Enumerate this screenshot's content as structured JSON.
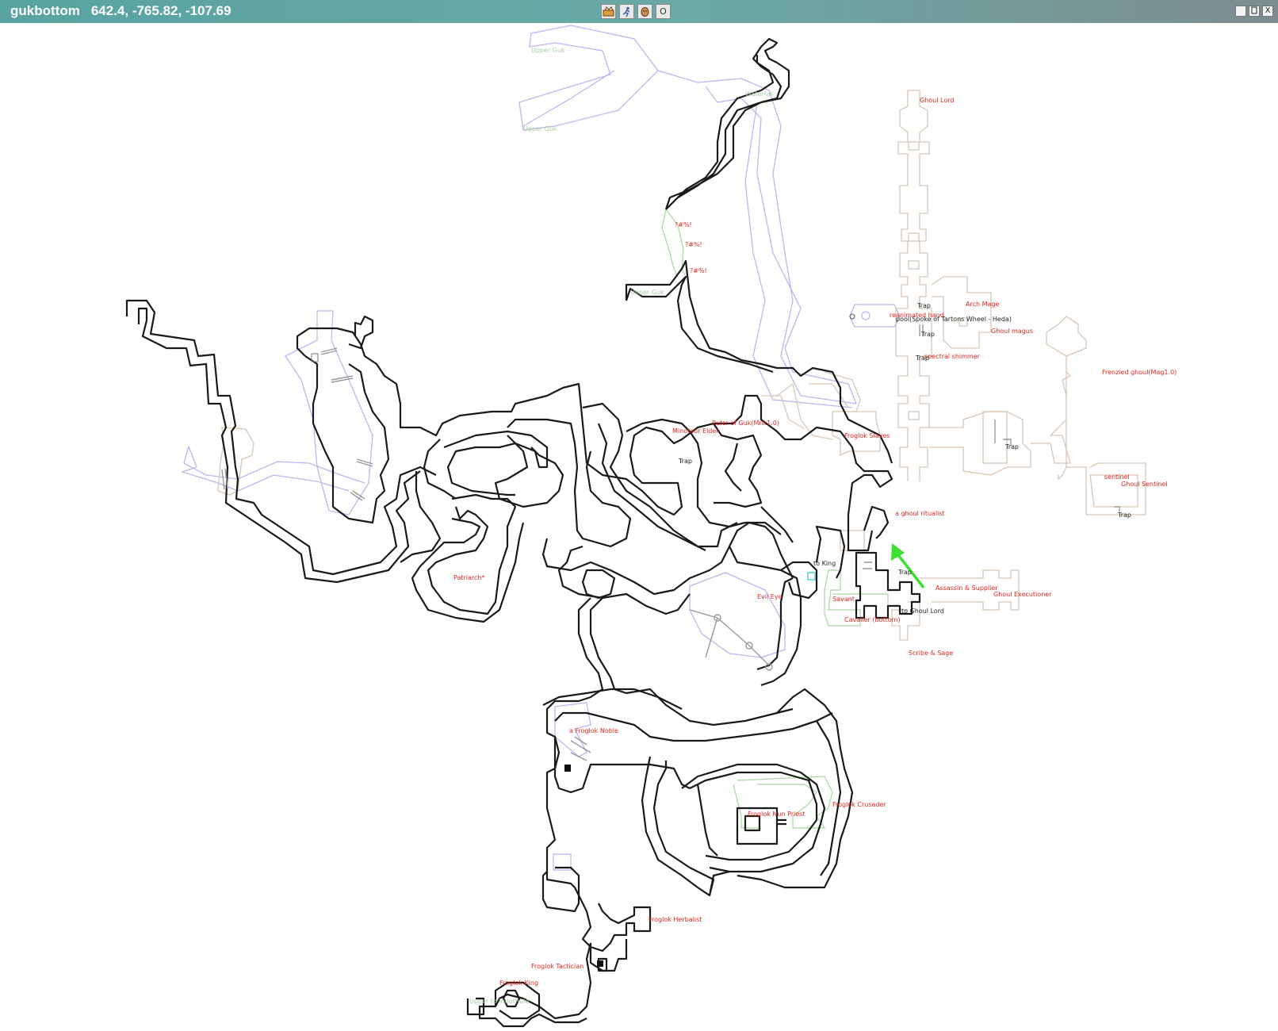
{
  "window": {
    "zone_name": "gukbottom",
    "coordinates": "642.4, -765.82, -107.69"
  },
  "toolbar": [
    {
      "icon": "map-tool-icon"
    },
    {
      "icon": "runner-icon"
    },
    {
      "icon": "head-icon"
    },
    {
      "icon": "circle-icon",
      "glyph": "O"
    }
  ],
  "window_buttons": {
    "minimize": "",
    "restore": "",
    "close": "X"
  },
  "labels": {
    "upper_guk_1": "Upper Guk",
    "upper_guk_2": "Upper Guk",
    "waterfall": "Waterfall",
    "upper_guk_small": "Upper Guk",
    "swear_1": "?#%!",
    "swear_2": "?#%!",
    "swear_3": "?#%!",
    "ghoul_lord": "Ghoul Lord",
    "trap_1": "Trap",
    "arch_mage": "Arch Mage",
    "reanimated_hand": "reanimated hand",
    "spoke": "pool(Spoke of Tartons Wheel - Heda)",
    "ghoul_magus": "Ghoul magus",
    "trap_2": "Trap",
    "spectral_shimmer": "spectral shimmer",
    "trap_3": "Trap",
    "frenzied_ghoul": "Frenzied ghoul(Mag1.0)",
    "minotaur_elder": "Minotaur Elder",
    "ruler_of_guk": "Ruler of Guk(Mnk1.0)",
    "froglok_slaves": "Froglok Slaves",
    "trap_4": "Trap",
    "trap_5": "Trap",
    "sentinel": "sentinel",
    "ghoul_sentinel": "Ghoul Sentinel",
    "trap_6": "Trap",
    "ghoul_ritualist": "a ghoul ritualist",
    "to_king": "to King",
    "trap_7": "Trap",
    "assassin_supplier": "Assassin & Supplier",
    "ghoul_executioner": "Ghoul Executioner",
    "patriarch": "Patriarch*",
    "evil_eye": "Evil Eye",
    "savant": "Savant",
    "to_ghoul_lord": "to Ghoul Lord",
    "cavalier": "Cavalier (bottom)",
    "scribe_sage": "Scribe & Sage",
    "froglok_noble": "a Froglok Noble",
    "froglok_crusader": "Froglok Crusader",
    "froglok_nun_priest": "Froglok Nun Priest",
    "froglok_herbalist": "Froglok Herbalist",
    "froglok_tactician": "Froglok Tactician",
    "froglok_king": "Froglok King",
    "upper_to_innothule": "Upper to Innothule"
  },
  "colors": {
    "titlebar": "#5fa5a2",
    "wall": "#1a1a1a",
    "water": "#b9b4ee",
    "ghoul_wing": "#d9c6b4",
    "passage": "#a6d8a0",
    "label_red": "#e0261f",
    "player_arrow": "#3de02f"
  },
  "player_marker": {
    "type": "arrow",
    "icon": "player-arrow-icon"
  }
}
